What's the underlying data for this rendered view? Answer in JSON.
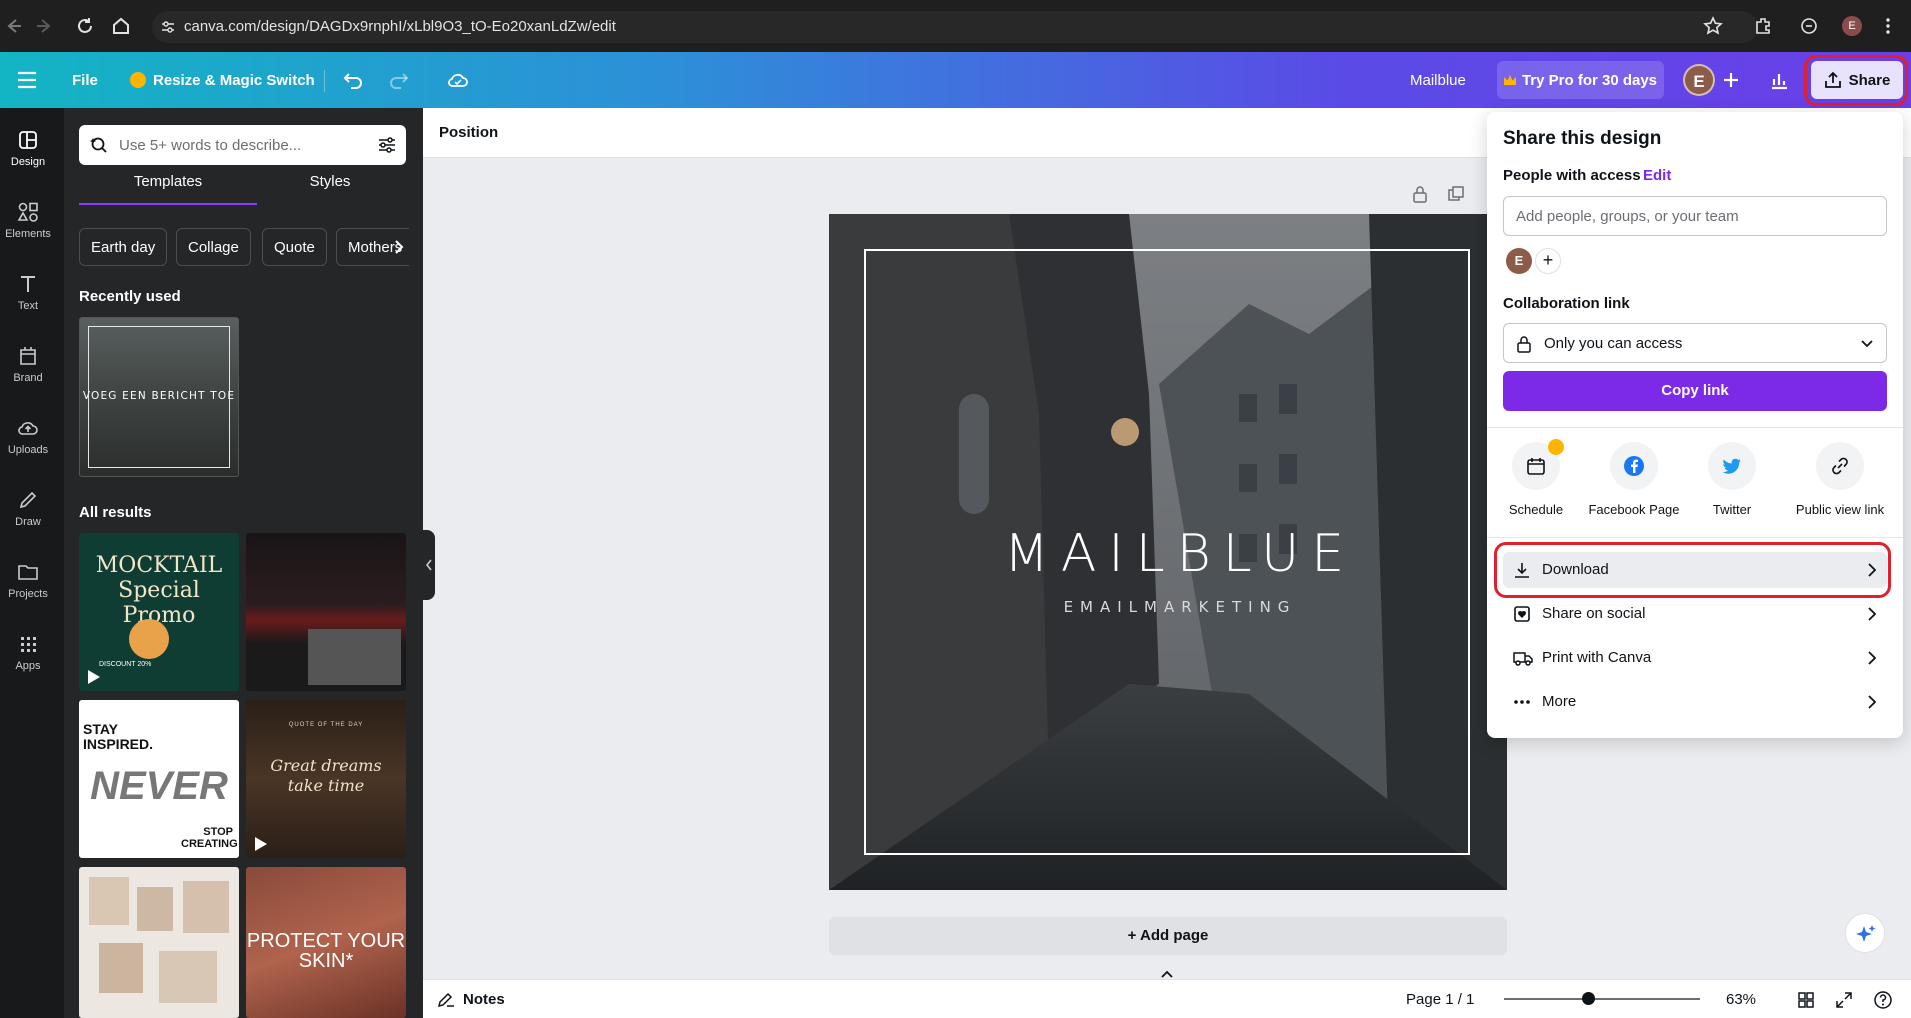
{
  "browser": {
    "url": "canva.com/design/DAGDx9rnphI/xLbl9O3_tO-Eo20xanLdZw/edit",
    "profile_initial": "E"
  },
  "topbar": {
    "menu_icon": "hamburger-icon",
    "file_label": "File",
    "resize_label": "Resize & Magic Switch",
    "design_title": "Mailblue",
    "pro_label": "Try Pro for 30 days",
    "avatar_initial": "E",
    "share_label": "Share"
  },
  "rail": {
    "items": [
      {
        "label": "Design",
        "icon": "design-icon"
      },
      {
        "label": "Elements",
        "icon": "elements-icon"
      },
      {
        "label": "Text",
        "icon": "text-icon"
      },
      {
        "label": "Brand",
        "icon": "brand-icon"
      },
      {
        "label": "Uploads",
        "icon": "uploads-icon"
      },
      {
        "label": "Draw",
        "icon": "draw-icon"
      },
      {
        "label": "Projects",
        "icon": "projects-icon"
      },
      {
        "label": "Apps",
        "icon": "apps-icon"
      }
    ]
  },
  "panel": {
    "search_placeholder": "Use 5+ words to describe...",
    "tabs": [
      "Templates",
      "Styles"
    ],
    "chips": [
      "Earth day",
      "Collage",
      "Quote",
      "Mothers"
    ],
    "recently_used": "Recently used",
    "recent_thumb_text": "VOEG EEN BERICHT TOE",
    "all_results": "All results",
    "results": [
      {
        "text": "MOCKTAIL Special Promo",
        "sub": "DISCOUNT 20%"
      },
      {
        "text": ""
      },
      {
        "text": "STAY INSPIRED.",
        "sub": "NEVER",
        "foot": "STOP CREATING"
      },
      {
        "text": "Great dreams take time",
        "sub": "QUOTE OF THE DAY"
      },
      {
        "text": ""
      },
      {
        "text": "PROTECT YOUR SKIN*"
      }
    ]
  },
  "canvas": {
    "position_label": "Position",
    "design_title": "MAILBLUE",
    "design_subtitle": "EMAILMARKETING",
    "add_page": "+ Add page"
  },
  "bottombar": {
    "notes": "Notes",
    "page": "Page 1 / 1",
    "zoom": "63%",
    "zoom_fraction": 0.43
  },
  "share_panel": {
    "title": "Share this design",
    "people_label": "People with access",
    "edit_label": "Edit",
    "add_placeholder": "Add people, groups, or your team",
    "avatar_initial": "E",
    "collab_label": "Collaboration link",
    "access_value": "Only you can access",
    "copy_label": "Copy link",
    "destinations": [
      {
        "label": "Schedule",
        "icon": "calendar-icon"
      },
      {
        "label": "Facebook Page",
        "icon": "facebook-icon"
      },
      {
        "label": "Twitter",
        "icon": "twitter-icon"
      },
      {
        "label": "Public view link",
        "icon": "link-icon"
      }
    ],
    "rows": [
      {
        "label": "Download",
        "icon": "download-icon"
      },
      {
        "label": "Share on social",
        "icon": "heart-icon"
      },
      {
        "label": "Print with Canva",
        "icon": "truck-icon"
      },
      {
        "label": "More",
        "icon": "more-icon"
      }
    ]
  },
  "colors": {
    "accent": "#7d2ae8",
    "highlight_ring": "#e0202d",
    "twitter": "#1d9bf0",
    "facebook": "#1877f2"
  }
}
